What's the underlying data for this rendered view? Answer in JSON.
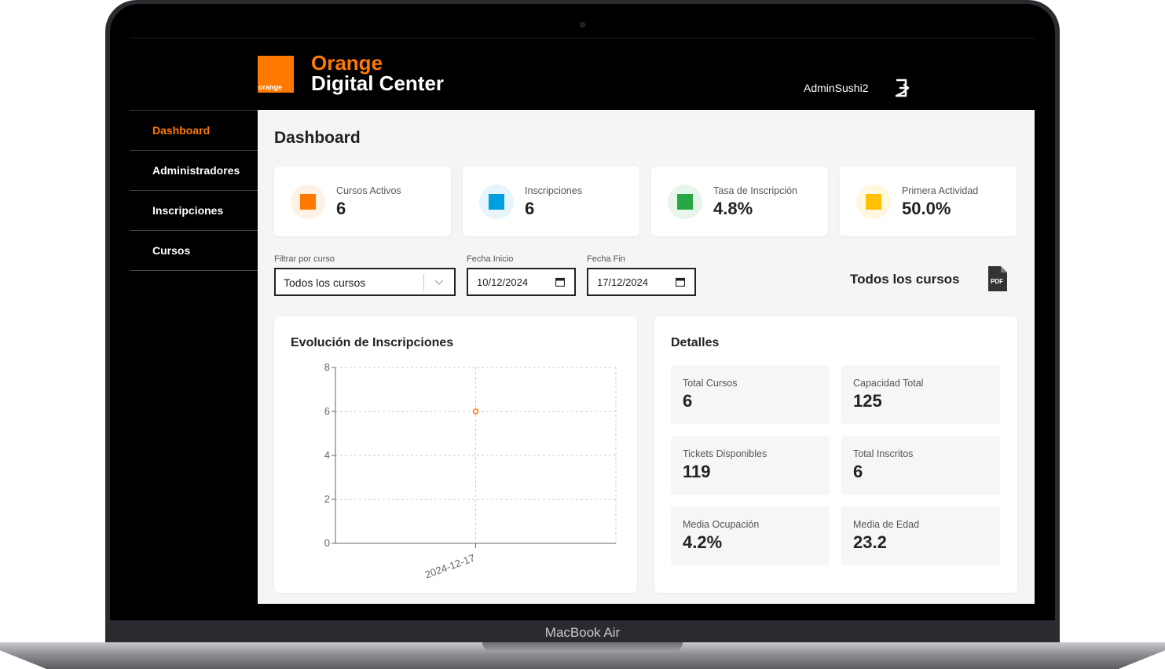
{
  "device": {
    "label": "MacBook Air"
  },
  "brand": {
    "logo_text": "orange",
    "line1": "Orange",
    "line2": "Digital Center",
    "color": "#ff7900"
  },
  "header": {
    "user": "AdminSushi2"
  },
  "sidebar": {
    "items": [
      {
        "label": "Dashboard",
        "active": true
      },
      {
        "label": "Administradores",
        "active": false
      },
      {
        "label": "Inscripciones",
        "active": false
      },
      {
        "label": "Cursos",
        "active": false
      }
    ]
  },
  "main": {
    "title": "Dashboard",
    "stats": [
      {
        "label": "Cursos Activos",
        "value": "6",
        "color": "#ff7900",
        "bg": "#fff1e6"
      },
      {
        "label": "Inscripciones",
        "value": "6",
        "color": "#00a0e0",
        "bg": "#e6f4fb"
      },
      {
        "label": "Tasa de Inscripción",
        "value": "4.8%",
        "color": "#28a745",
        "bg": "#e8f5ea"
      },
      {
        "label": "Primera Actividad",
        "value": "50.0%",
        "color": "#ffc000",
        "bg": "#fff8e1"
      }
    ],
    "filters": {
      "course_label": "Filtrar por curso",
      "course_value": "Todos los cursos",
      "start_label": "Fecha Inicio",
      "start_value": "10/12/2024",
      "end_label": "Fecha Fin",
      "end_value": "17/12/2024"
    },
    "selected_course_title": "Todos los cursos",
    "pdf_label": "PDF",
    "chart_panel_title": "Evolución de Inscripciones",
    "details_title": "Detalles",
    "details": [
      {
        "label": "Total Cursos",
        "value": "6"
      },
      {
        "label": "Capacidad Total",
        "value": "125"
      },
      {
        "label": "Tickets Disponibles",
        "value": "119"
      },
      {
        "label": "Total Inscritos",
        "value": "6"
      },
      {
        "label": "Media Ocupación",
        "value": "4.2%"
      },
      {
        "label": "Media de Edad",
        "value": "23.2"
      }
    ]
  },
  "chart_data": {
    "type": "line",
    "x": [
      "2024-12-17"
    ],
    "series": [
      {
        "values": [
          6
        ]
      }
    ],
    "yticks": [
      0,
      2,
      4,
      6,
      8
    ],
    "ylim": [
      0,
      8
    ],
    "grid": true,
    "color": "#ff7900"
  }
}
